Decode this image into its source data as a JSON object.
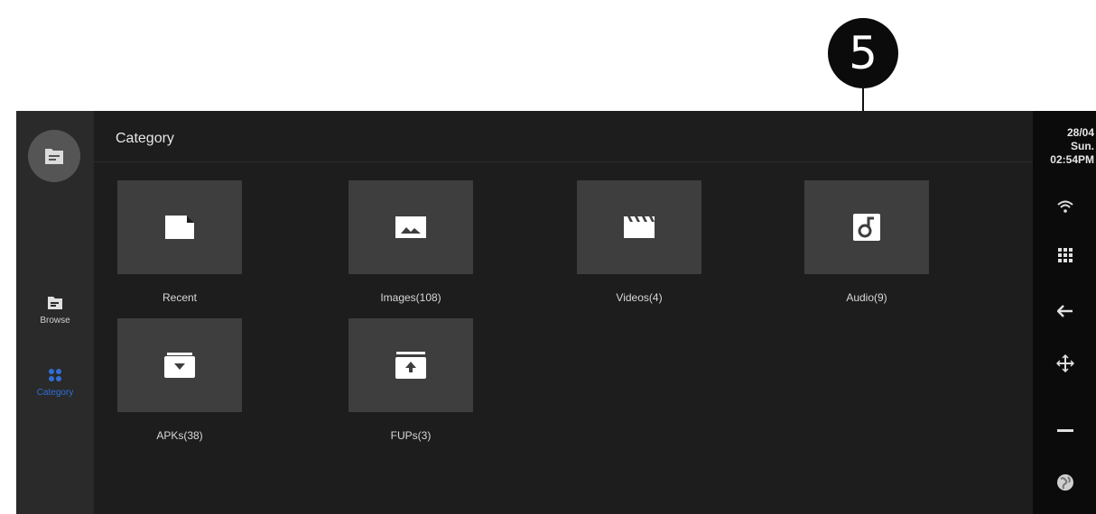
{
  "callout": {
    "number": "5"
  },
  "sidebar": {
    "items": [
      {
        "label": "Browse",
        "icon": "folder-icon",
        "active": false
      },
      {
        "label": "Category",
        "icon": "grid-icon",
        "active": true
      }
    ]
  },
  "main": {
    "title": "Category",
    "tiles": [
      {
        "label": "Recent",
        "icon": "file-icon"
      },
      {
        "label": "Images(108)",
        "icon": "image-icon"
      },
      {
        "label": "Videos(4)",
        "icon": "clapper-icon"
      },
      {
        "label": "Audio(9)",
        "icon": "music-icon"
      },
      {
        "label": "APKs(38)",
        "icon": "download-box-icon"
      },
      {
        "label": "FUPs(3)",
        "icon": "upload-box-icon"
      }
    ]
  },
  "status": {
    "date": "28/04",
    "day": "Sun.",
    "time": "02:54PM",
    "icons": [
      "wifi-icon",
      "apps-icon",
      "back-icon",
      "move-icon",
      "minus-icon",
      "globe-icon"
    ]
  },
  "colors": {
    "background": "#1d1d1d",
    "sidebar": "#2a2a2a",
    "tile": "#3e3e3e",
    "active": "#2f6fd6",
    "status_bar": "#0b0b0b"
  }
}
